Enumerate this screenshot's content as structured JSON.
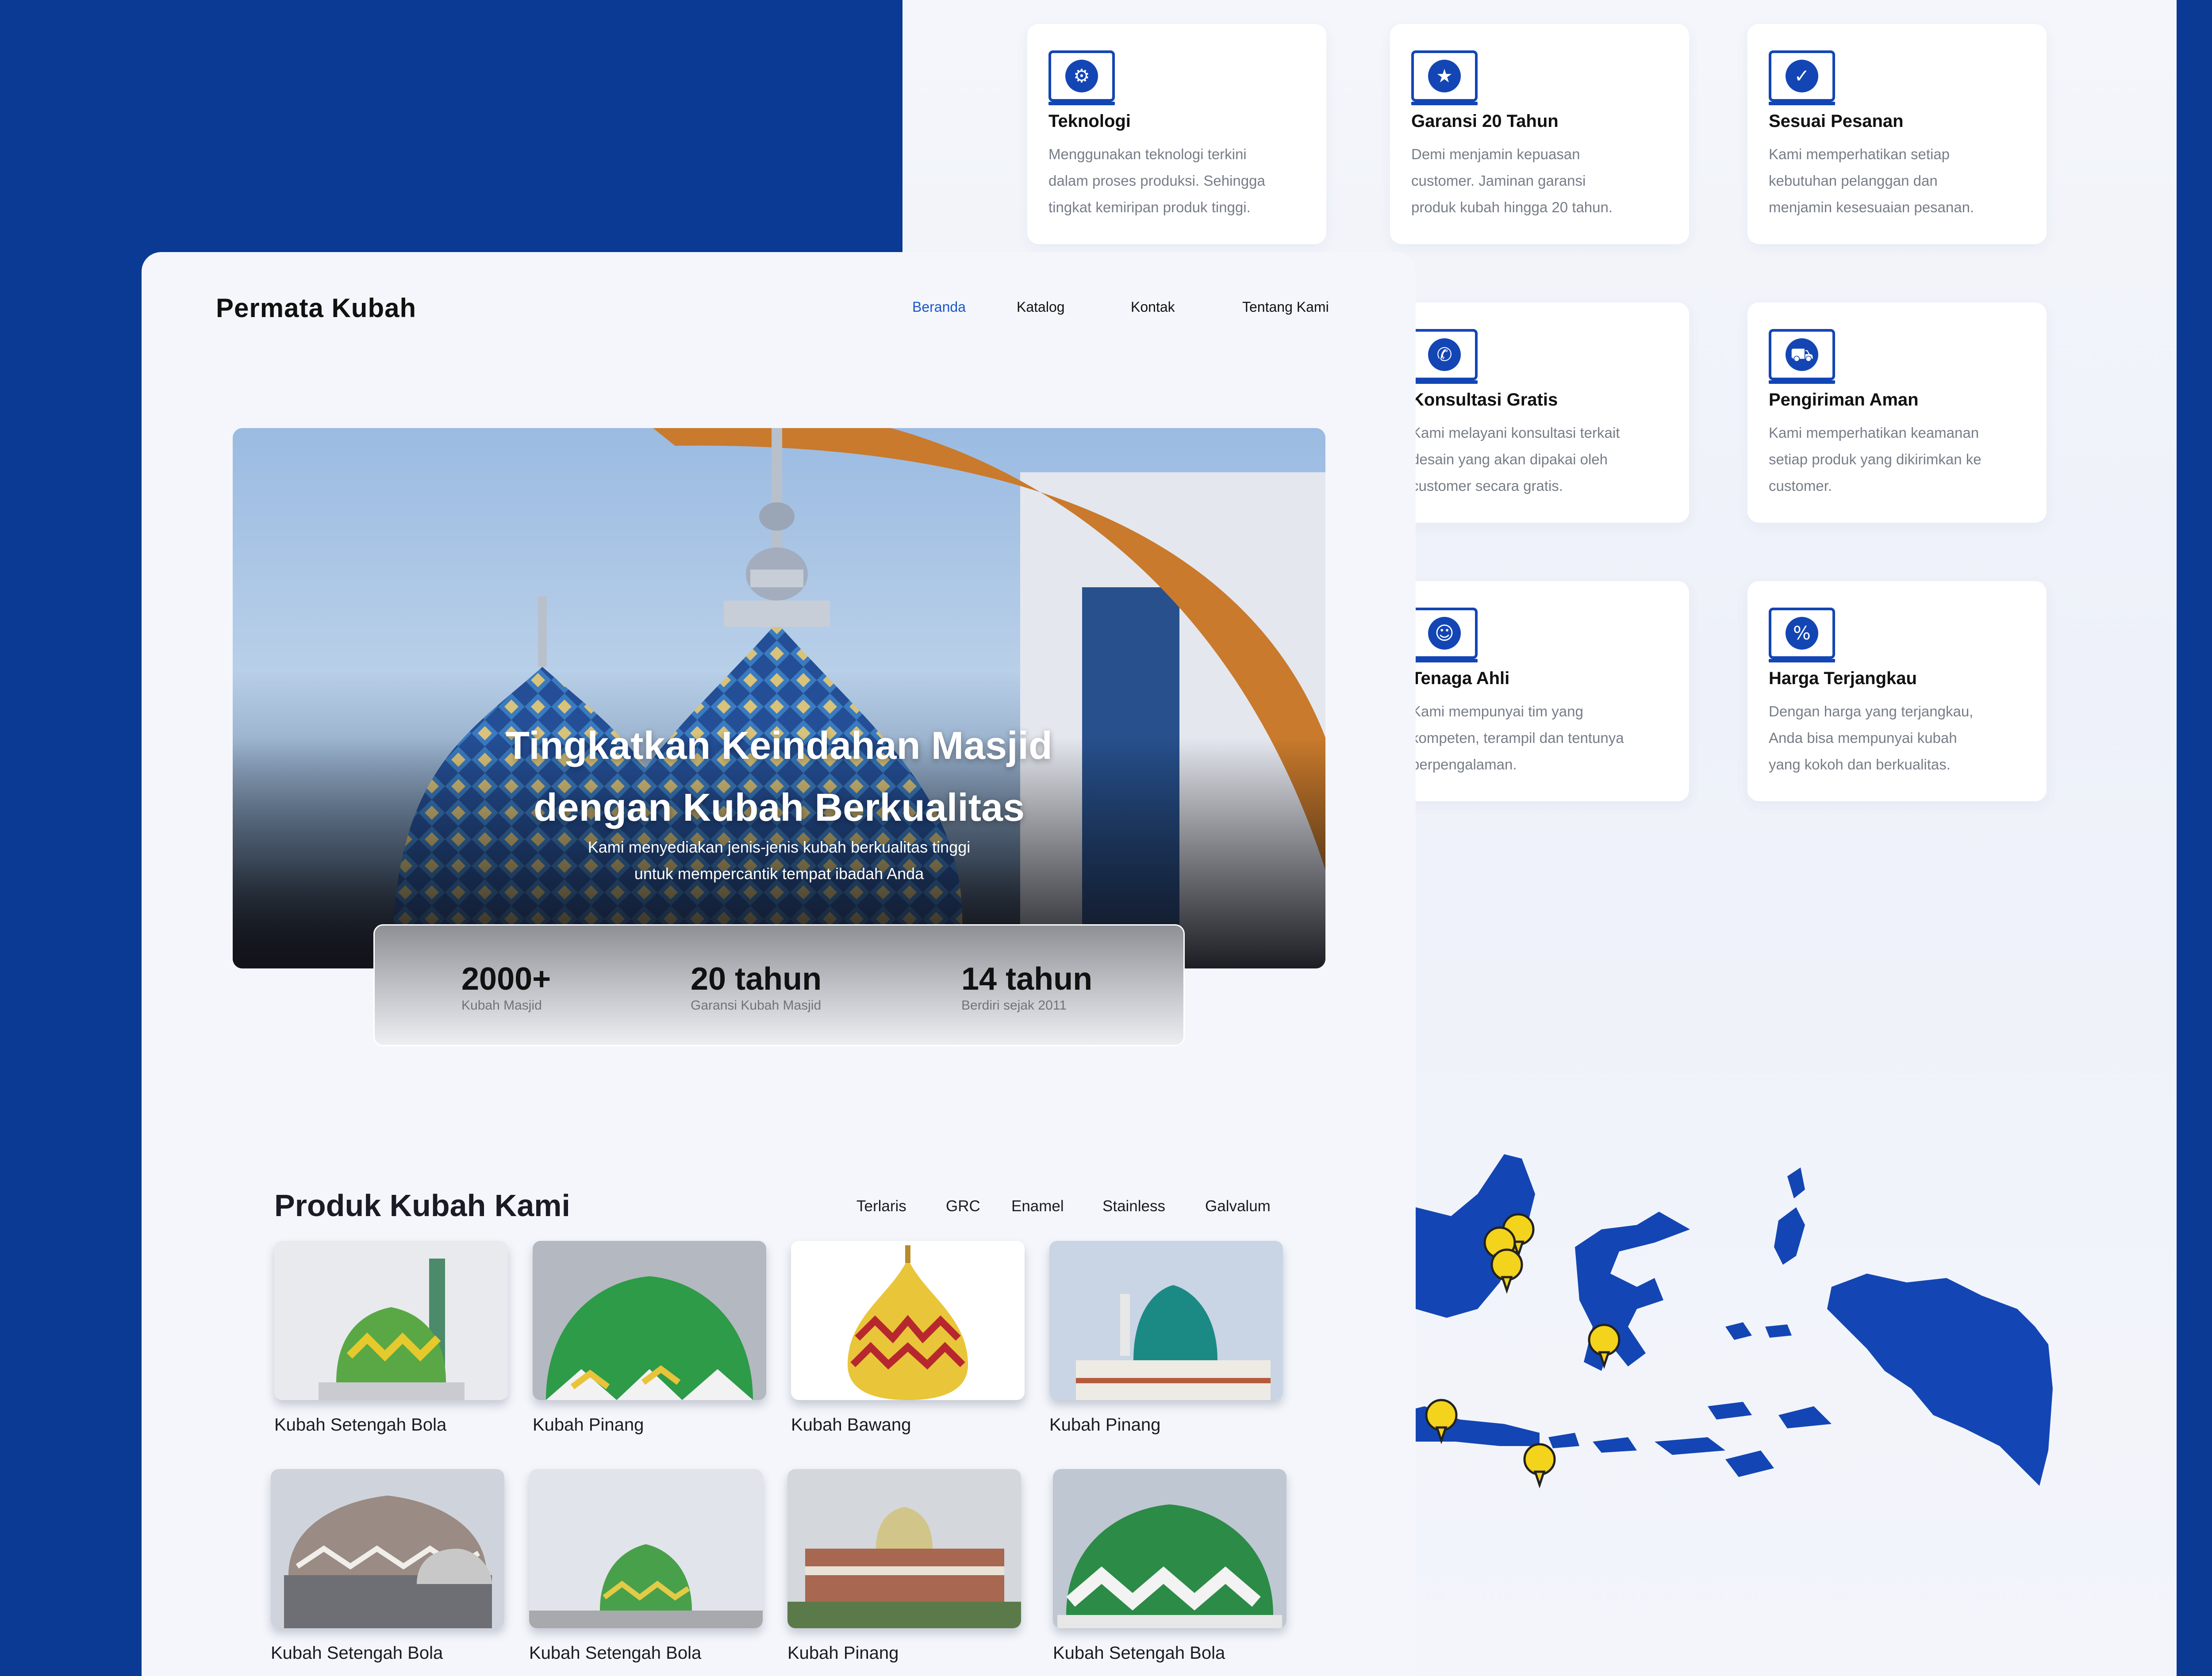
{
  "features": [
    {
      "title": "Teknologi",
      "icon": "gear-icon",
      "glyph": "⚙",
      "lines": [
        "Menggunakan teknologi terkini",
        "dalam proses produksi. Sehingga",
        "tingkat kemiripan produk tinggi."
      ]
    },
    {
      "title": "Garansi 20 Tahun",
      "icon": "warranty-badge-icon",
      "glyph": "★",
      "lines": [
        "Demi menjamin kepuasan",
        "customer. Jaminan garansi",
        "produk kubah hingga 20 tahun."
      ]
    },
    {
      "title": "Sesuai Pesanan",
      "icon": "order-checklist-icon",
      "glyph": "✓",
      "lines": [
        "Kami memperhatikan setiap",
        "kebutuhan pelanggan dan",
        "menjamin kesesuaian pesanan."
      ]
    },
    {
      "title": "Konsultasi Gratis",
      "icon": "whatsapp-icon",
      "glyph": "✆",
      "lines": [
        "Kami melayani konsultasi terkait",
        "desain yang akan dipakai oleh",
        "customer secara gratis."
      ]
    },
    {
      "title": "Pengiriman Aman",
      "icon": "secure-truck-icon",
      "glyph": "⛟",
      "lines": [
        "Kami memperhatikan keamanan",
        "setiap produk yang dikirimkan ke",
        "customer."
      ]
    },
    {
      "title": "Tenaga Ahli",
      "icon": "team-icon",
      "glyph": "☺",
      "lines": [
        "Kami mempunyai tim yang",
        "kompeten, terampil dan tentunya",
        "berpengalaman."
      ]
    },
    {
      "title": "Harga Terjangkau",
      "icon": "discount-bag-icon",
      "glyph": "%",
      "lines": [
        "Dengan harga yang terjangkau,",
        "Anda bisa mempunyai kubah",
        "yang kokoh dan berkualitas."
      ]
    }
  ],
  "brand": "Permata Kubah",
  "nav": [
    "Beranda",
    "Katalog",
    "Kontak",
    "Tentang Kami"
  ],
  "hero": {
    "title_line1": "Tingkatkan Keindahan Masjid",
    "title_line2": "dengan Kubah Berkualitas",
    "subtitle_line1": "Kami menyediakan jenis-jenis kubah berkualitas tinggi",
    "subtitle_line2": "untuk mempercantik tempat ibadah Anda"
  },
  "stats": [
    {
      "value": "2000+",
      "label": "Kubah Masjid"
    },
    {
      "value": "20 tahun",
      "label": "Garansi Kubah Masjid"
    },
    {
      "value": "14 tahun",
      "label": "Berdiri sejak 2011"
    }
  ],
  "products_section": {
    "title": "Produk Kubah Kami",
    "filters": [
      "Terlaris",
      "GRC",
      "Enamel",
      "Stainless",
      "Galvalum"
    ]
  },
  "products": [
    {
      "name": "Kubah Setengah Bola"
    },
    {
      "name": "Kubah Pinang"
    },
    {
      "name": "Kubah Bawang"
    },
    {
      "name": "Kubah Pinang"
    },
    {
      "name": "Kubah Setengah Bola"
    },
    {
      "name": "Kubah Setengah Bola"
    },
    {
      "name": "Kubah Pinang"
    },
    {
      "name": "Kubah Setengah Bola"
    }
  ],
  "colors": {
    "brand_blue": "#0a3a94",
    "accent_blue": "#1a57c8",
    "map_blue": "#1346b4",
    "pin_yellow": "#f3d31b"
  }
}
